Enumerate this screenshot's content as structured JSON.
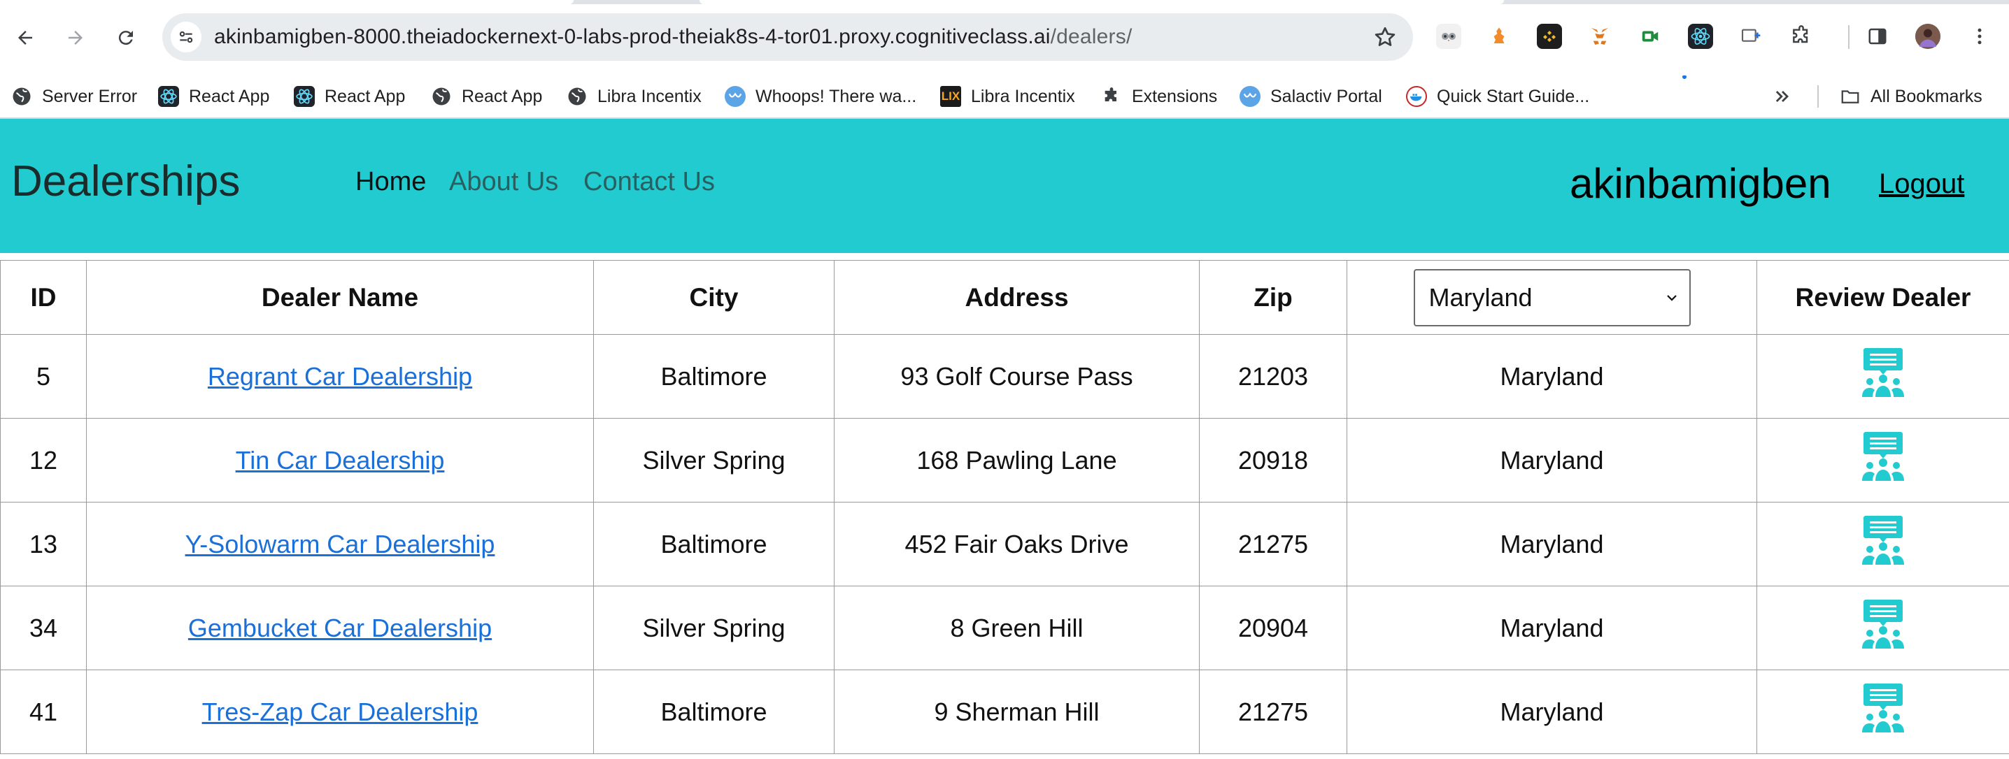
{
  "browser": {
    "url_host": "akinbamigben-8000.theiadockernext-0-labs-prod-theiak8s-4-tor01.proxy.cognitiveclass.ai",
    "url_path": "/dealers/",
    "bookmarks": [
      {
        "label": "Server Error",
        "icon": "globe-icon"
      },
      {
        "label": "React App",
        "icon": "react-icon"
      },
      {
        "label": "React App",
        "icon": "react-icon"
      },
      {
        "label": "React App",
        "icon": "globe-icon"
      },
      {
        "label": "Libra Incentix",
        "icon": "globe-icon"
      },
      {
        "label": "Whoops! There wa...",
        "icon": "whoops-icon"
      },
      {
        "label": "Libra Incentix",
        "icon": "lix-icon"
      },
      {
        "label": "Extensions",
        "icon": "puzzle-icon"
      },
      {
        "label": "Salactiv Portal",
        "icon": "salactiv-icon"
      },
      {
        "label": "Quick Start Guide...",
        "icon": "docker-icon"
      }
    ],
    "all_bookmarks_label": "All Bookmarks"
  },
  "header": {
    "brand": "Dealerships",
    "nav": [
      "Home",
      "About Us",
      "Contact Us"
    ],
    "username": "akinbamigben",
    "logout": "Logout",
    "bg_color": "#22cbd0"
  },
  "table": {
    "columns": [
      "ID",
      "Dealer Name",
      "City",
      "Address",
      "Zip",
      "Review Dealer"
    ],
    "state_filter": "Maryland",
    "rows": [
      {
        "id": "5",
        "name": "Regrant Car Dealership",
        "city": "Baltimore",
        "address": "93 Golf Course Pass",
        "zip": "21203",
        "state": "Maryland"
      },
      {
        "id": "12",
        "name": "Tin Car Dealership",
        "city": "Silver Spring",
        "address": "168 Pawling Lane",
        "zip": "20918",
        "state": "Maryland"
      },
      {
        "id": "13",
        "name": "Y-Solowarm Car Dealership",
        "city": "Baltimore",
        "address": "452 Fair Oaks Drive",
        "zip": "21275",
        "state": "Maryland"
      },
      {
        "id": "34",
        "name": "Gembucket Car Dealership",
        "city": "Silver Spring",
        "address": "8 Green Hill",
        "zip": "20904",
        "state": "Maryland"
      },
      {
        "id": "41",
        "name": "Tres-Zap Car Dealership",
        "city": "Baltimore",
        "address": "9 Sherman Hill",
        "zip": "21275",
        "state": "Maryland"
      }
    ],
    "link_color": "#1a6fd8",
    "review_icon_color": "#22cbd0"
  }
}
